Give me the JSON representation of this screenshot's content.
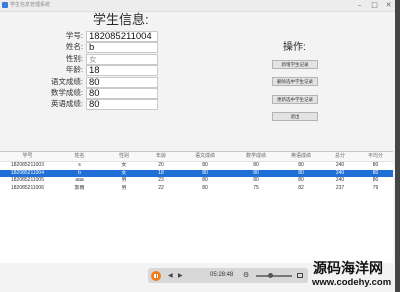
{
  "window": {
    "title": "学生信息管理系统",
    "icons": {
      "app": "app-icon",
      "minimize": "minimize-icon",
      "maximize": "maximize-icon",
      "close": "close-icon"
    }
  },
  "form": {
    "heading": "学生信息:",
    "fields": [
      {
        "label": "学号:",
        "value": "182085211004"
      },
      {
        "label": "姓名:",
        "value": "b"
      },
      {
        "label": "性别:",
        "value": "女"
      },
      {
        "label": "年龄:",
        "value": "18"
      },
      {
        "label": "语文成绩:",
        "value": "80"
      },
      {
        "label": "数学成绩:",
        "value": "80"
      },
      {
        "label": "英语成绩:",
        "value": "80"
      }
    ]
  },
  "actions": {
    "heading": "操作:",
    "buttons": [
      {
        "label": "新增学生记录"
      },
      {
        "label": "删除选中学生记录"
      },
      {
        "label": "更新选中学生记录"
      },
      {
        "label": "退出"
      }
    ]
  },
  "table": {
    "columns": [
      "学号",
      "姓名",
      "性别",
      "年龄",
      "语文成绩",
      "数学成绩",
      "英语成绩",
      "总分",
      "平均分"
    ],
    "rows": [
      [
        "182085211003",
        "s",
        "女",
        "20",
        "80",
        "80",
        "80",
        "240",
        "80"
      ],
      [
        "182085211004",
        "b",
        "女",
        "18",
        "80",
        "80",
        "80",
        "240",
        "80"
      ],
      [
        "182085211005",
        "aaa",
        "男",
        "23",
        "80",
        "80",
        "80",
        "240",
        "80"
      ],
      [
        "182085211006",
        "郭雨",
        "男",
        "22",
        "80",
        "75",
        "82",
        "237",
        "79"
      ]
    ],
    "selected_row_index": 1
  },
  "player": {
    "time": "05:28:48",
    "slider_level": 0.4,
    "icons": [
      "pause-icon",
      "previous-icon",
      "next-icon",
      "settings-icon",
      "fullscreen-icon"
    ]
  },
  "watermark": {
    "name": "源码海洋网",
    "url": "www.codehy.com"
  },
  "colors": {
    "window_background": "#f3f3f3",
    "table_background": "#ffffff",
    "selected_row": "#1f6fd6",
    "button_background": "#e3e3e3",
    "player_accent": "#f07c1a",
    "frame": "#454545"
  }
}
